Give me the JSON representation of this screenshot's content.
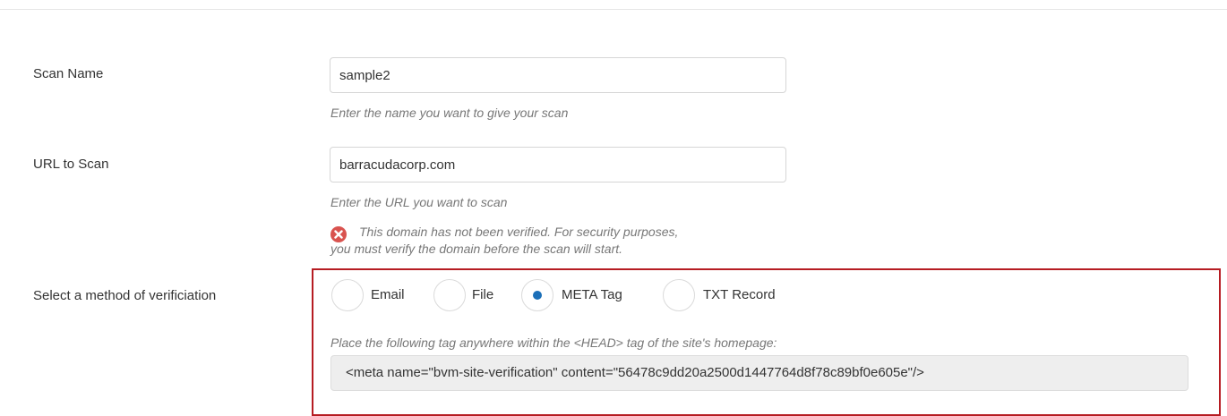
{
  "form": {
    "scan_name": {
      "label": "Scan Name",
      "value": "sample2",
      "help": "Enter the name you want to give your scan"
    },
    "url": {
      "label": "URL to Scan",
      "value": "barracudacorp.com",
      "help": "Enter the URL you want to scan",
      "error_line1": "This domain has not been verified. For security purposes,",
      "error_line2": "you must verify the domain before the scan will start."
    },
    "verification": {
      "label": "Select a method of verificiation",
      "options": [
        {
          "label": "Email",
          "checked": false
        },
        {
          "label": "File",
          "checked": false
        },
        {
          "label": "META Tag",
          "checked": true
        },
        {
          "label": "TXT Record",
          "checked": false
        }
      ],
      "tag_help": "Place the following tag anywhere within the <HEAD> tag of the site's homepage:",
      "meta_tag": "<meta name=\"bvm-site-verification\" content=\"56478c9dd20a2500d1447764d8f78c89bf0e605e\"/>"
    }
  },
  "colors": {
    "accent": "#1b6fb8",
    "error": "#d9534f",
    "highlight_frame": "#b61c22"
  },
  "icons": {
    "error": "error-x-circle-icon"
  }
}
